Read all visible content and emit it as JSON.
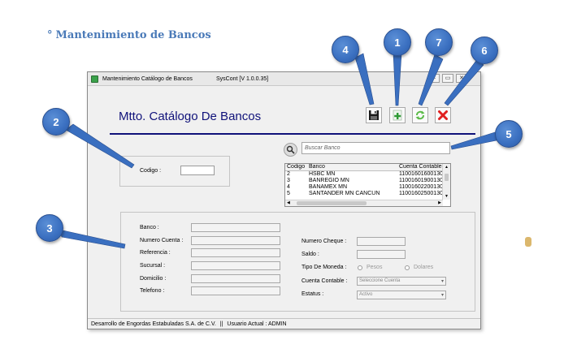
{
  "doc": {
    "heading_bullet": "°",
    "heading": "Mantenimiento de Bancos"
  },
  "window": {
    "title": "Mantenimiento Catálogo de Bancos",
    "version": "SysCont [V 1.0.0.35]",
    "controls": [
      "minimize-icon",
      "maximize-icon",
      "close-icon"
    ]
  },
  "form": {
    "title": "Mtto. Catálogo De Bancos"
  },
  "toolbar": {
    "buttons": [
      {
        "name": "save-icon",
        "color": "#1a1a1a"
      },
      {
        "name": "add-icon",
        "color": "#2f9a35"
      },
      {
        "name": "refresh-icon",
        "color": "#5cbb49"
      },
      {
        "name": "delete-icon",
        "color": "#e02020"
      }
    ]
  },
  "codigo": {
    "label": "Codigo :",
    "value": ""
  },
  "search": {
    "icon": "magnifier-icon",
    "placeholder": "Buscar Banco"
  },
  "bank_grid": {
    "columns": [
      "Codigo",
      "Banco",
      "Cuenta Contable"
    ],
    "rows": [
      [
        "2",
        "HSBC MN",
        "11001601600130"
      ],
      [
        "3",
        "BANREGIO MN",
        "11001601900130"
      ],
      [
        "4",
        "BANAMEX MN",
        "11001602200130"
      ],
      [
        "5",
        "SANTANDER MN CANCUN",
        "11001602500130"
      ]
    ]
  },
  "details": {
    "banco_label": "Banco :",
    "numero_cuenta_label": "Numero Cuenta :",
    "referencia_label": "Referencia :",
    "sucursal_label": "Sucursal :",
    "domicilio_label": "Domicilio :",
    "telefono_label": "Telefono :",
    "numero_cheque_label": "Numero Cheque :",
    "saldo_label": "Saldo :",
    "tipo_moneda_label": "Tipo De Moneda :",
    "moneda_options": [
      "Pesos",
      "Dolares"
    ],
    "cuenta_contable_label": "Cuenta Contable :",
    "cuenta_contable_value": "Seleccione Cuenta",
    "estatus_label": "Estatus :",
    "estatus_value": "Activo"
  },
  "status_bar": {
    "company": "Desarrollo de Engordas Estabuladas S.A. de C.V.",
    "separator": "||",
    "user": "Usuario Actual : ADMIN"
  },
  "callouts": [
    "1",
    "2",
    "3",
    "4",
    "5",
    "6",
    "7"
  ],
  "colors": {
    "badge": "#3a6fc0",
    "form_title": "#10127a",
    "doc_heading": "#4a7ab8"
  }
}
